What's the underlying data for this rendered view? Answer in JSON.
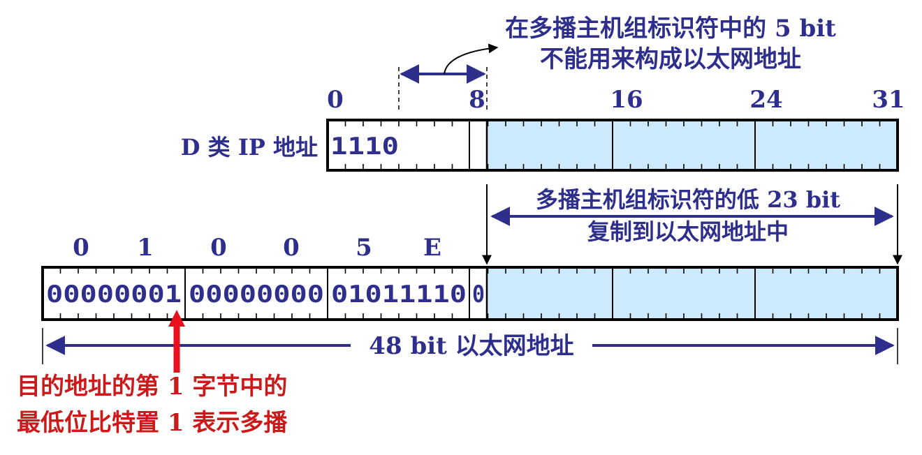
{
  "annotation_top": {
    "line1": "在多播主机组标识符中的 5 bit",
    "line2": "不能用来构成以太网地址"
  },
  "ip_address": {
    "label": "D 类 IP 地址",
    "prefix_bits": "1110",
    "bit_positions": [
      "0",
      "8",
      "16",
      "24",
      "31"
    ]
  },
  "copy_annotation": {
    "line1": "多播主机组标识符的低 23 bit",
    "line2": "复制到以太网地址中"
  },
  "ethernet_address": {
    "hex_digits": [
      "0",
      "1",
      "0",
      "0",
      "5",
      "E"
    ],
    "byte1": "00000001",
    "byte2": "00000000",
    "byte3": "01011110",
    "bit25": "0",
    "length_label": "48 bit 以太网地址"
  },
  "multicast_note": {
    "line1": "目的地址的第 1 字节中的",
    "line2": "最低位比特置 1 表示多播"
  },
  "colors": {
    "text": "#2e2e8c",
    "arrow": "#2e2e8c",
    "highlight_fill": "#cdeafc",
    "red_arrow": "#e8101c",
    "box_stroke": "#000000"
  }
}
